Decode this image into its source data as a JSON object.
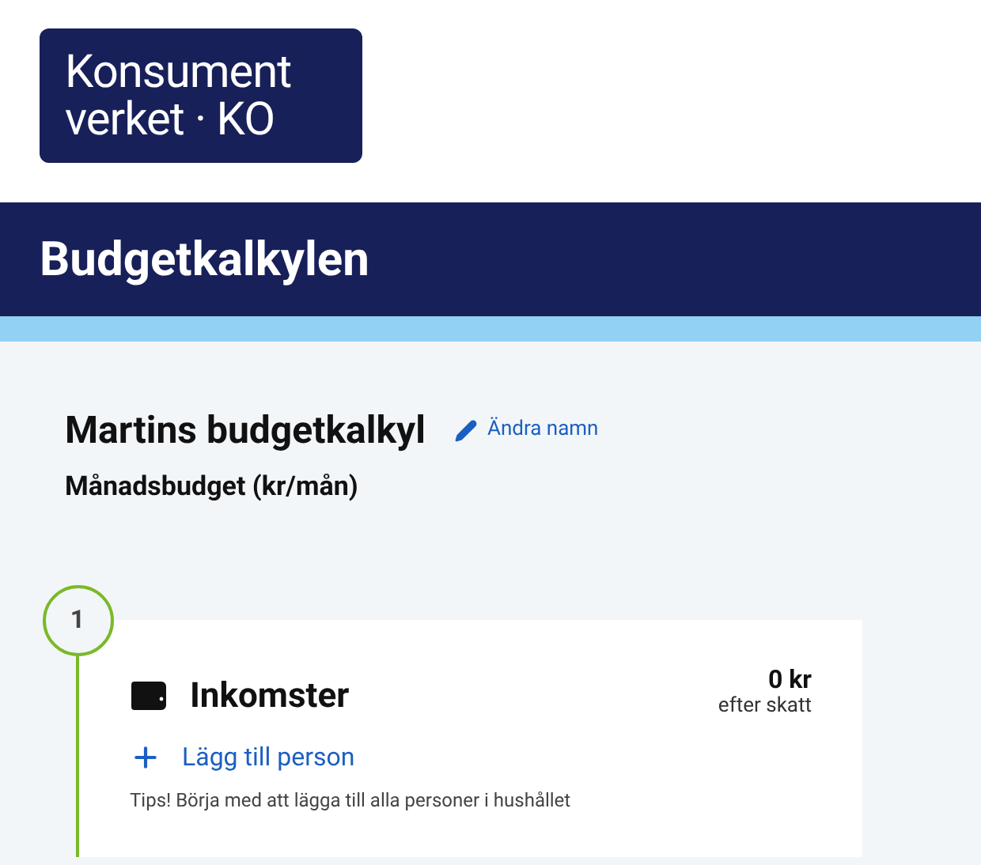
{
  "logo": {
    "lines": [
      "Konsument",
      "verket · KO"
    ]
  },
  "header": {
    "title": "Budgetkalkylen"
  },
  "budget": {
    "name": "Martins budgetkalkyl",
    "rename_link": "Ändra namn",
    "subtitle": "Månadsbudget (kr/mån)"
  },
  "steps": [
    {
      "number": "1",
      "title": "Inkomster",
      "amount": "0 kr",
      "amount_note": "efter skatt",
      "action": "Lägg till person",
      "tip": "Tips! Börja med att lägga till alla personer i hushållet"
    }
  ]
}
